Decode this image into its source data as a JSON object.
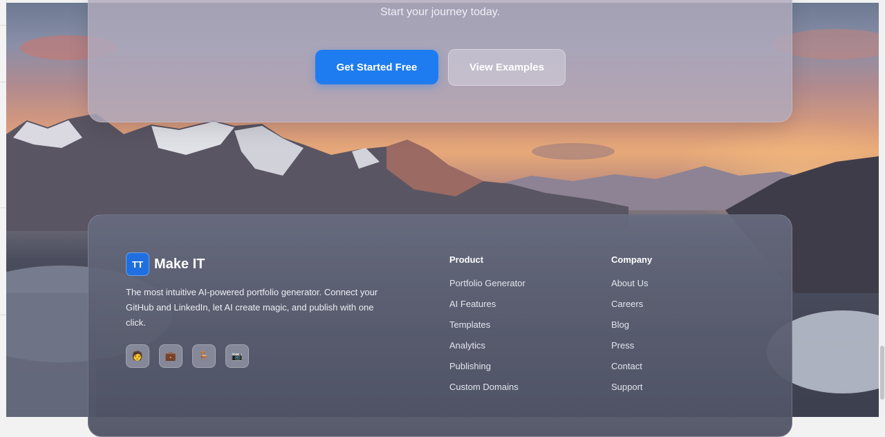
{
  "cta": {
    "subtitle": "Start your journey today.",
    "primary_button": "Get Started Free",
    "secondary_button": "View Examples"
  },
  "footer": {
    "brand": {
      "logo_text": "TT",
      "name": "Make IT",
      "description": "The most intuitive AI-powered portfolio generator. Connect your GitHub and LinkedIn, let AI create magic, and publish with one click."
    },
    "socials": [
      {
        "icon": "person-icon",
        "glyph": "🧑"
      },
      {
        "icon": "briefcase-icon",
        "glyph": "💼"
      },
      {
        "icon": "chair-icon",
        "glyph": "🪑"
      },
      {
        "icon": "camera-icon",
        "glyph": "📷"
      }
    ],
    "product": {
      "title": "Product",
      "links": [
        "Portfolio Generator",
        "AI Features",
        "Templates",
        "Analytics",
        "Publishing",
        "Custom Domains"
      ]
    },
    "company": {
      "title": "Company",
      "links": [
        "About Us",
        "Careers",
        "Blog",
        "Press",
        "Contact",
        "Support"
      ]
    }
  },
  "colors": {
    "primary": "#1f7cf0",
    "logo": "#1f6fe0"
  }
}
